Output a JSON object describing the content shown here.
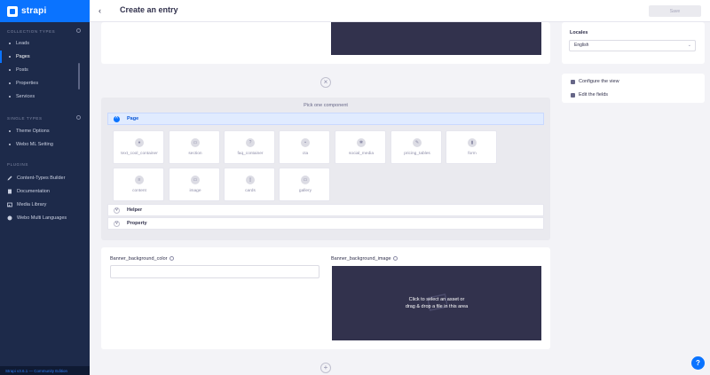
{
  "brand": {
    "name": "strapi"
  },
  "sidebar": {
    "collection_title": "Collection Types",
    "collection_items": [
      "Leads",
      "Pages",
      "Posts",
      "Properties",
      "Services"
    ],
    "single_title": "Single Types",
    "single_items": [
      "Theme Options",
      "Webo ML Setting"
    ],
    "plugins_title": "Plugins",
    "plugin_items": [
      "Content-Types Builder",
      "Documentation",
      "Media Library",
      "Webo Multi Languages"
    ],
    "version": "Strapi v3.6.1 — Community Edition"
  },
  "header": {
    "title": "Create an entry",
    "save_label": "Save"
  },
  "picker": {
    "title": "Pick one component",
    "categories": [
      "Page",
      "Helper",
      "Property"
    ],
    "components": [
      "text_cool_container",
      "section",
      "faq_container",
      "cta",
      "social_media",
      "pricing_tables",
      "form",
      "content",
      "image",
      "cards",
      "gallery"
    ]
  },
  "fields": {
    "bg_color_label": "Banner_background_color",
    "bg_image_label": "Banner_background_image",
    "media_hint_line1": "Click to select an asset or",
    "media_hint_line2": "drag & drop a file in this area"
  },
  "right_panel": {
    "locales_label": "Locales",
    "locale_value": "English",
    "configure_label": "Configure the view",
    "edit_fields_label": "Edit the fields"
  },
  "colors": {
    "accent": "#0a73ff",
    "sidebar": "#1d2a4a",
    "media": "#32324d"
  }
}
